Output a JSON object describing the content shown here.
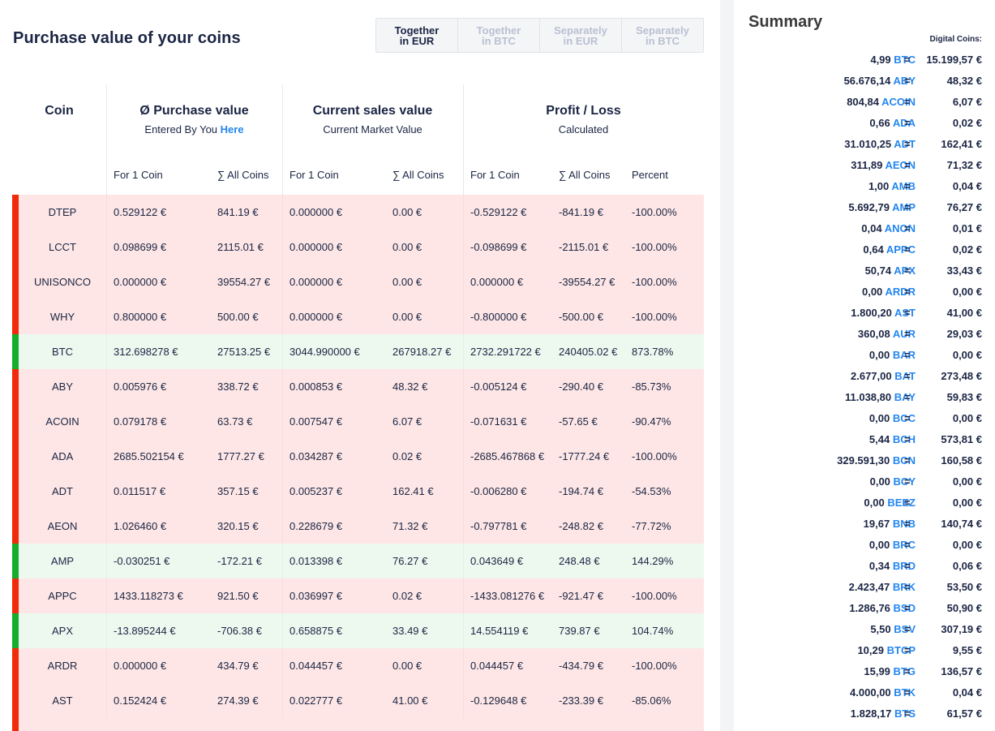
{
  "page": {
    "title": "Purchase value of your coins"
  },
  "view_tabs": [
    {
      "label": "Together\nin EUR",
      "active": true
    },
    {
      "label": "Together\nin BTC",
      "active": false
    },
    {
      "label": "Separately\nin EUR",
      "active": false
    },
    {
      "label": "Separately\nin BTC",
      "active": false
    }
  ],
  "table": {
    "groups": {
      "coin": {
        "title": "Coin"
      },
      "purchase": {
        "title": "Ø Purchase value",
        "subtitle": "Entered By You",
        "link": "Here"
      },
      "current": {
        "title": "Current sales value",
        "subtitle": "Current Market Value"
      },
      "profit": {
        "title": "Profit / Loss",
        "subtitle": "Calculated"
      }
    },
    "columns": {
      "purchase_one": "For 1 Coin",
      "purchase_all": "∑ All Coins",
      "current_one": "For 1 Coin",
      "current_all": "∑ All Coins",
      "profit_one": "For 1 Coin",
      "profit_all": "∑ All Coins",
      "percent": "Percent"
    },
    "rows": [
      {
        "coin": "DTEP",
        "status": "loss",
        "purchase_one": "0.529122 €",
        "purchase_all": "841.19 €",
        "current_one": "0.000000 €",
        "current_all": "0.00 €",
        "profit_one": "-0.529122 €",
        "profit_all": "-841.19 €",
        "percent": "-100.00%"
      },
      {
        "coin": "LCCT",
        "status": "loss",
        "purchase_one": "0.098699 €",
        "purchase_all": "2115.01 €",
        "current_one": "0.000000 €",
        "current_all": "0.00 €",
        "profit_one": "-0.098699 €",
        "profit_all": "-2115.01 €",
        "percent": "-100.00%"
      },
      {
        "coin": "UNISONCO",
        "status": "loss",
        "purchase_one": "0.000000 €",
        "purchase_all": "39554.27 €",
        "current_one": "0.000000 €",
        "current_all": "0.00 €",
        "profit_one": "0.000000 €",
        "profit_all": "-39554.27 €",
        "percent": "-100.00%"
      },
      {
        "coin": "WHY",
        "status": "loss",
        "purchase_one": "0.800000 €",
        "purchase_all": "500.00 €",
        "current_one": "0.000000 €",
        "current_all": "0.00 €",
        "profit_one": "-0.800000 €",
        "profit_all": "-500.00 €",
        "percent": "-100.00%"
      },
      {
        "coin": "BTC",
        "status": "gain",
        "purchase_one": "312.698278 €",
        "purchase_all": "27513.25 €",
        "current_one": "3044.990000 €",
        "current_all": "267918.27 €",
        "profit_one": "2732.291722 €",
        "profit_all": "240405.02 €",
        "percent": "873.78%"
      },
      {
        "coin": "ABY",
        "status": "loss",
        "purchase_one": "0.005976 €",
        "purchase_all": "338.72 €",
        "current_one": "0.000853 €",
        "current_all": "48.32 €",
        "profit_one": "-0.005124 €",
        "profit_all": "-290.40 €",
        "percent": "-85.73%"
      },
      {
        "coin": "ACOIN",
        "status": "loss",
        "purchase_one": "0.079178 €",
        "purchase_all": "63.73 €",
        "current_one": "0.007547 €",
        "current_all": "6.07 €",
        "profit_one": "-0.071631 €",
        "profit_all": "-57.65 €",
        "percent": "-90.47%"
      },
      {
        "coin": "ADA",
        "status": "loss",
        "purchase_one": "2685.502154 €",
        "purchase_all": "1777.27 €",
        "current_one": "0.034287 €",
        "current_all": "0.02 €",
        "profit_one": "-2685.467868 €",
        "profit_all": "-1777.24 €",
        "percent": "-100.00%"
      },
      {
        "coin": "ADT",
        "status": "loss",
        "purchase_one": "0.011517 €",
        "purchase_all": "357.15 €",
        "current_one": "0.005237 €",
        "current_all": "162.41 €",
        "profit_one": "-0.006280 €",
        "profit_all": "-194.74 €",
        "percent": "-54.53%"
      },
      {
        "coin": "AEON",
        "status": "loss",
        "purchase_one": "1.026460 €",
        "purchase_all": "320.15 €",
        "current_one": "0.228679 €",
        "current_all": "71.32 €",
        "profit_one": "-0.797781 €",
        "profit_all": "-248.82 €",
        "percent": "-77.72%"
      },
      {
        "coin": "AMP",
        "status": "gain",
        "purchase_one": "-0.030251 €",
        "purchase_all": "-172.21 €",
        "current_one": "0.013398 €",
        "current_all": "76.27 €",
        "profit_one": "0.043649 €",
        "profit_all": "248.48 €",
        "percent": "144.29%"
      },
      {
        "coin": "APPC",
        "status": "loss",
        "purchase_one": "1433.118273 €",
        "purchase_all": "921.50 €",
        "current_one": "0.036997 €",
        "current_all": "0.02 €",
        "profit_one": "-1433.081276 €",
        "profit_all": "-921.47 €",
        "percent": "-100.00%"
      },
      {
        "coin": "APX",
        "status": "gain",
        "purchase_one": "-13.895244 €",
        "purchase_all": "-706.38 €",
        "current_one": "0.658875 €",
        "current_all": "33.49 €",
        "profit_one": "14.554119 €",
        "profit_all": "739.87 €",
        "percent": "104.74%"
      },
      {
        "coin": "ARDR",
        "status": "loss",
        "purchase_one": "0.000000 €",
        "purchase_all": "434.79 €",
        "current_one": "0.044457 €",
        "current_all": "0.00 €",
        "profit_one": "0.044457 €",
        "profit_all": "-434.79 €",
        "percent": "-100.00%"
      },
      {
        "coin": "AST",
        "status": "loss",
        "purchase_one": "0.152424 €",
        "purchase_all": "274.39 €",
        "current_one": "0.022777 €",
        "current_all": "41.00 €",
        "profit_one": "-0.129648 €",
        "profit_all": "-233.39 €",
        "percent": "-85.06%"
      }
    ]
  },
  "summary": {
    "title": "Summary",
    "digital_coins_label": "Digital Coins:",
    "equals": "=",
    "items": [
      {
        "amount": "4,99",
        "symbol": "BTC",
        "value": "15.199,57 €"
      },
      {
        "amount": "56.676,14",
        "symbol": "ABY",
        "value": "48,32 €"
      },
      {
        "amount": "804,84",
        "symbol": "ACOIN",
        "value": "6,07 €"
      },
      {
        "amount": "0,66",
        "symbol": "ADA",
        "value": "0,02 €"
      },
      {
        "amount": "31.010,25",
        "symbol": "ADT",
        "value": "162,41 €"
      },
      {
        "amount": "311,89",
        "symbol": "AEON",
        "value": "71,32 €"
      },
      {
        "amount": "1,00",
        "symbol": "AMB",
        "value": "0,04 €"
      },
      {
        "amount": "5.692,79",
        "symbol": "AMP",
        "value": "76,27 €"
      },
      {
        "amount": "0,04",
        "symbol": "ANON",
        "value": "0,01 €"
      },
      {
        "amount": "0,64",
        "symbol": "APPC",
        "value": "0,02 €"
      },
      {
        "amount": "50,74",
        "symbol": "APX",
        "value": "33,43 €"
      },
      {
        "amount": "0,00",
        "symbol": "ARDR",
        "value": "0,00 €"
      },
      {
        "amount": "1.800,20",
        "symbol": "AST",
        "value": "41,00 €"
      },
      {
        "amount": "360,08",
        "symbol": "AUR",
        "value": "29,03 €"
      },
      {
        "amount": "0,00",
        "symbol": "BAR",
        "value": "0,00 €"
      },
      {
        "amount": "2.677,00",
        "symbol": "BAT",
        "value": "273,48 €"
      },
      {
        "amount": "11.038,80",
        "symbol": "BAY",
        "value": "59,83 €"
      },
      {
        "amount": "0,00",
        "symbol": "BCC",
        "value": "0,00 €"
      },
      {
        "amount": "5,44",
        "symbol": "BCH",
        "value": "573,81 €"
      },
      {
        "amount": "329.591,30",
        "symbol": "BCN",
        "value": "160,58 €"
      },
      {
        "amount": "0,00",
        "symbol": "BCY",
        "value": "0,00 €"
      },
      {
        "amount": "0,00",
        "symbol": "BEEZ",
        "value": "0,00 €"
      },
      {
        "amount": "19,67",
        "symbol": "BNB",
        "value": "140,74 €"
      },
      {
        "amount": "0,00",
        "symbol": "BRC",
        "value": "0,00 €"
      },
      {
        "amount": "0,34",
        "symbol": "BRD",
        "value": "0,06 €"
      },
      {
        "amount": "2.423,47",
        "symbol": "BRK",
        "value": "53,50 €"
      },
      {
        "amount": "1.286,76",
        "symbol": "BSD",
        "value": "50,90 €"
      },
      {
        "amount": "5,50",
        "symbol": "BSV",
        "value": "307,19 €"
      },
      {
        "amount": "10,29",
        "symbol": "BTCP",
        "value": "9,55 €"
      },
      {
        "amount": "15,99",
        "symbol": "BTG",
        "value": "136,57 €"
      },
      {
        "amount": "4.000,00",
        "symbol": "BTK",
        "value": "0,04 €"
      },
      {
        "amount": "1.828,17",
        "symbol": "BTS",
        "value": "61,57 €"
      }
    ]
  },
  "colors": {
    "loss_bg": "#fde6e5",
    "loss_bar": "#f02a0b",
    "gain_bg": "#edf8ef",
    "gain_bar": "#16ad2a",
    "link": "#2386f0",
    "text": "#1b2544"
  }
}
